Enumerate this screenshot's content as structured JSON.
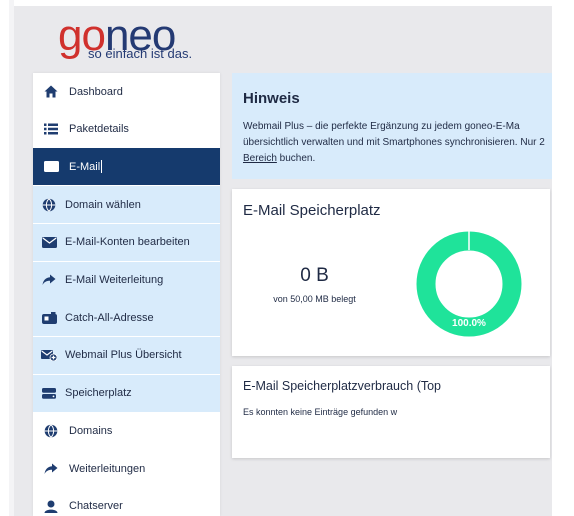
{
  "logo": {
    "brand_first": "go",
    "brand_rest": "neo",
    "tagline": "so einfach ist das."
  },
  "sidebar": {
    "items": [
      {
        "label": "Dashboard",
        "icon": "home-icon",
        "state": "normal"
      },
      {
        "label": "Paketdetails",
        "icon": "list-icon",
        "state": "normal"
      },
      {
        "label": "E-Mail",
        "icon": "envelope-icon",
        "state": "active"
      },
      {
        "label": "Domain wählen",
        "icon": "globe-icon",
        "state": "sub"
      },
      {
        "label": "E-Mail-Konten bearbeiten",
        "icon": "envelope-icon",
        "state": "sub"
      },
      {
        "label": "E-Mail Weiterleitung",
        "icon": "forward-arrow-icon",
        "state": "sub"
      },
      {
        "label": "Catch-All-Adresse",
        "icon": "mailbox-icon",
        "state": "sub"
      },
      {
        "label": "Webmail Plus Übersicht",
        "icon": "envelope-plus-icon",
        "state": "sub"
      },
      {
        "label": "Speicherplatz",
        "icon": "storage-icon",
        "state": "sub"
      },
      {
        "label": "Domains",
        "icon": "globe-icon",
        "state": "normal"
      },
      {
        "label": "Weiterleitungen",
        "icon": "forward-arrow-icon",
        "state": "normal"
      },
      {
        "label": "Chatserver",
        "icon": "chat-user-icon",
        "state": "normal"
      }
    ]
  },
  "hint": {
    "title": "Hinweis",
    "line1": "Webmail Plus – die perfekte Ergänzung zu jedem goneo-E-Ma",
    "line2": "übersichtlich verwalten und mit Smartphones synchronisieren. Nur 2",
    "link": "Bereich",
    "line3_rest": " buchen."
  },
  "storage": {
    "title": "E-Mail Speicherplatz",
    "used": "0 B",
    "subtitle": "von 50,00 MB belegt",
    "percent_label": "100.0%",
    "free_fraction": 1.0,
    "color": "#1fe39a"
  },
  "usage": {
    "title": "E-Mail Speicherplatzverbrauch (Top",
    "empty_text": "Es konnten keine Einträge gefunden w"
  },
  "colors": {
    "active_bg": "#153a6d",
    "sub_bg": "#d8ebfb",
    "brand_red": "#d0312d",
    "brand_blue": "#243a73"
  }
}
